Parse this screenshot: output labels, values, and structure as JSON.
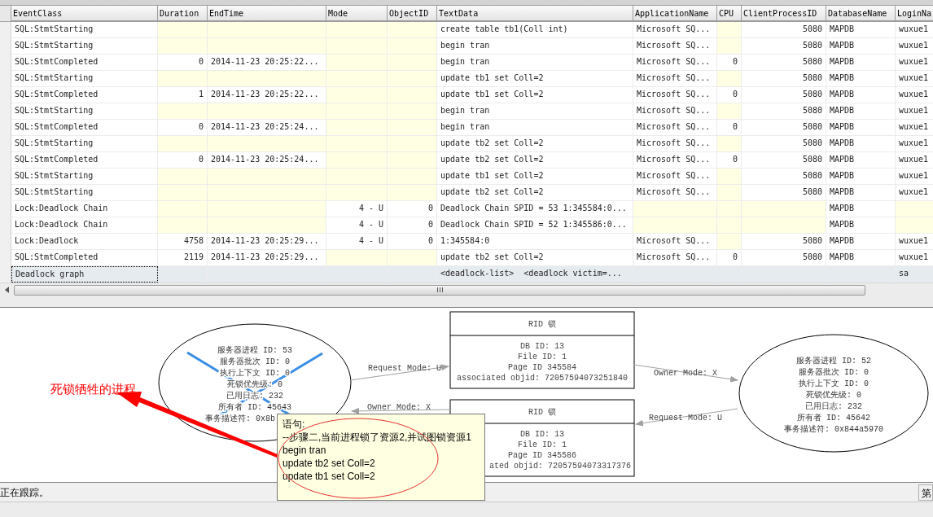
{
  "grid": {
    "columns": [
      "EventClass",
      "Duration",
      "EndTime",
      "Mode",
      "ObjectID",
      "TextData",
      "ApplicationName",
      "CPU",
      "ClientProcessID",
      "DatabaseName",
      "LoginNa"
    ],
    "rows": [
      {
        "selected": false,
        "cells": [
          "SQL:StmtStarting",
          null,
          null,
          null,
          null,
          "create table tb1(Coll int)",
          "Microsoft SQ...",
          null,
          "5080",
          "MAPDB",
          "wuxue1"
        ]
      },
      {
        "selected": false,
        "cells": [
          "SQL:StmtStarting",
          null,
          null,
          null,
          null,
          "begin tran",
          "Microsoft SQ...",
          null,
          "5080",
          "MAPDB",
          "wuxue1"
        ]
      },
      {
        "selected": false,
        "cells": [
          "SQL:StmtCompleted",
          "0",
          "2014-11-23 20:25:22...",
          null,
          null,
          "begin tran",
          "Microsoft SQ...",
          "0",
          "5080",
          "MAPDB",
          "wuxue1"
        ]
      },
      {
        "selected": false,
        "cells": [
          "SQL:StmtStarting",
          null,
          null,
          null,
          null,
          "update tb1 set Coll=2",
          "Microsoft SQ...",
          null,
          "5080",
          "MAPDB",
          "wuxue1"
        ]
      },
      {
        "selected": false,
        "cells": [
          "SQL:StmtCompleted",
          "1",
          "2014-11-23 20:25:22...",
          null,
          null,
          "update tb1 set Coll=2",
          "Microsoft SQ...",
          "0",
          "5080",
          "MAPDB",
          "wuxue1"
        ]
      },
      {
        "selected": false,
        "cells": [
          "SQL:StmtStarting",
          null,
          null,
          null,
          null,
          "begin tran",
          "Microsoft SQ...",
          null,
          "5080",
          "MAPDB",
          "wuxue1"
        ]
      },
      {
        "selected": false,
        "cells": [
          "SQL:StmtCompleted",
          "0",
          "2014-11-23 20:25:24...",
          null,
          null,
          "begin tran",
          "Microsoft SQ...",
          "0",
          "5080",
          "MAPDB",
          "wuxue1"
        ]
      },
      {
        "selected": false,
        "cells": [
          "SQL:StmtStarting",
          null,
          null,
          null,
          null,
          "update tb2 set Coll=2",
          "Microsoft SQ...",
          null,
          "5080",
          "MAPDB",
          "wuxue1"
        ]
      },
      {
        "selected": false,
        "cells": [
          "SQL:StmtCompleted",
          "0",
          "2014-11-23 20:25:24...",
          null,
          null,
          "update tb2 set Coll=2",
          "Microsoft SQ...",
          "0",
          "5080",
          "MAPDB",
          "wuxue1"
        ]
      },
      {
        "selected": false,
        "cells": [
          "SQL:StmtStarting",
          null,
          null,
          null,
          null,
          "update tb1 set Coll=2",
          "Microsoft SQ...",
          null,
          "5080",
          "MAPDB",
          "wuxue1"
        ]
      },
      {
        "selected": false,
        "cells": [
          "SQL:StmtStarting",
          null,
          null,
          null,
          null,
          "update tb2 set Coll=2",
          "Microsoft SQ...",
          null,
          "5080",
          "MAPDB",
          "wuxue1"
        ]
      },
      {
        "selected": false,
        "cells": [
          "Lock:Deadlock Chain",
          null,
          null,
          "4 - U",
          "0",
          "Deadlock Chain SPID = 53 1:345584:0...",
          null,
          null,
          null,
          "MAPDB",
          null
        ]
      },
      {
        "selected": false,
        "cells": [
          "Lock:Deadlock Chain",
          null,
          null,
          "4 - U",
          "0",
          "Deadlock Chain SPID = 52 1:345586:0...",
          null,
          null,
          null,
          "MAPDB",
          null
        ]
      },
      {
        "selected": false,
        "cells": [
          "Lock:Deadlock",
          "4758",
          "2014-11-23 20:25:29...",
          "4 - U",
          "0",
          "1:345584:0",
          "Microsoft SQ...",
          null,
          "5080",
          "MAPDB",
          "wuxue1"
        ]
      },
      {
        "selected": false,
        "cells": [
          "SQL:StmtCompleted",
          "2119",
          "2014-11-23 20:25:29...",
          null,
          null,
          "update tb2 set Coll=2",
          "Microsoft SQ...",
          "0",
          "5080",
          "MAPDB",
          "wuxue1"
        ]
      },
      {
        "selected": true,
        "cells": [
          "Deadlock graph",
          null,
          null,
          null,
          null,
          "<deadlock-list>  <deadlock victim=...",
          null,
          null,
          null,
          null,
          "sa"
        ]
      }
    ]
  },
  "graph": {
    "processes": [
      {
        "victim": true,
        "lines": [
          "服务器进程 ID: 53",
          "服务器批次 ID: 0",
          "执行上下文 ID: 0",
          "死锁优先级: 0",
          "已用日志: 232",
          "所有者 ID: 45643",
          "事务描述符: 0x8b"
        ]
      },
      {
        "victim": false,
        "lines": [
          "服务器进程 ID: 52",
          "服务器批次 ID: 0",
          "执行上下文 ID: 0",
          "死锁优先级: 0",
          "已用日志: 232",
          "所有者 ID: 45642",
          "事务描述符: 0x844a5970"
        ]
      }
    ],
    "resources": [
      {
        "title": "RID 锁",
        "lines": [
          "DB ID: 13",
          "File ID: 1",
          "Page ID 345584",
          "associated objid: 72057594073251840"
        ]
      },
      {
        "title": "RID 锁",
        "lines": [
          "DB ID: 13",
          "File ID: 1",
          "Page ID 345586",
          "ated objid: 72057594073317376"
        ]
      }
    ],
    "edges": [
      {
        "label": "Request Mode: U"
      },
      {
        "label": "Owner Mode: X"
      },
      {
        "label": "Owner Mode: X"
      },
      {
        "label": "Request Mode: U"
      }
    ]
  },
  "tooltip": {
    "lines": [
      "语句:",
      "--步骤二,当前进程锁了资源2,并试图锁资源1",
      "begin tran",
      "update tb2 set Coll=2",
      "update tb1 set Coll=2"
    ]
  },
  "annotation": {
    "label": "死锁牺牲的进程"
  },
  "status_bar": {
    "text": "正在跟踪。",
    "panel": "第"
  }
}
